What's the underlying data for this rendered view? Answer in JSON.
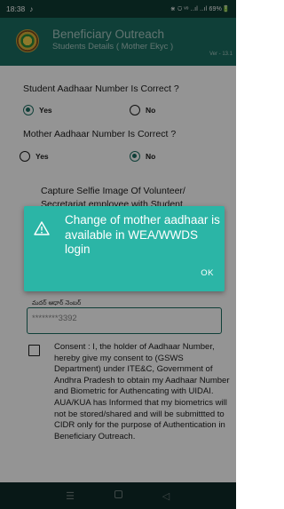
{
  "status_bar": {
    "time": "18:38",
    "music_icon": "music-note-icon",
    "right_text": "⋇ ⩂ ᵛᵒ ..ıl ..ıl 69%🔋"
  },
  "app_bar": {
    "title": "Beneficiary Outreach",
    "subtitle": "Students Details ( Mother Ekyc )",
    "version": "Ver - 13.1"
  },
  "form": {
    "q1": {
      "label": "Student Aadhaar Number Is Correct ?",
      "yes": "Yes",
      "no": "No",
      "selected": "yes"
    },
    "q2": {
      "label": "Mother Aadhaar Number Is Correct ?",
      "yes": "Yes",
      "no": "No",
      "selected": "no"
    },
    "selfie_label": "Capture Selfie Image Of Volunteer/ Secretariat employee with Student",
    "aadhaar_label": "మదర్ ఆధార్ నెంబర్",
    "aadhaar_value": "********3392",
    "consent": "Consent : I, the holder of Aadhaar Number, hereby give my consent to (GSWS Department) under ITE&C, Government of Andhra Pradesh to obtain my Aadhaar Number and Biometric for Authencating with UIDAI. AUA/KUA has Informed that my biometrics will not be stored/shared and will be submittted to CIDR only for the purpose of Authentication in Beneficiary Outreach."
  },
  "dialog": {
    "message": "Change of mother aadhaar is available in WEA/WWDS login",
    "ok_label": "OK"
  },
  "nav": {
    "menu_glyph": "☰",
    "back_glyph": "◁"
  },
  "colors": {
    "status_bar": "#0e3b33",
    "app_bar": "#1b6d61",
    "dialog": "#2bb5a6",
    "accent": "#1b6d61"
  }
}
